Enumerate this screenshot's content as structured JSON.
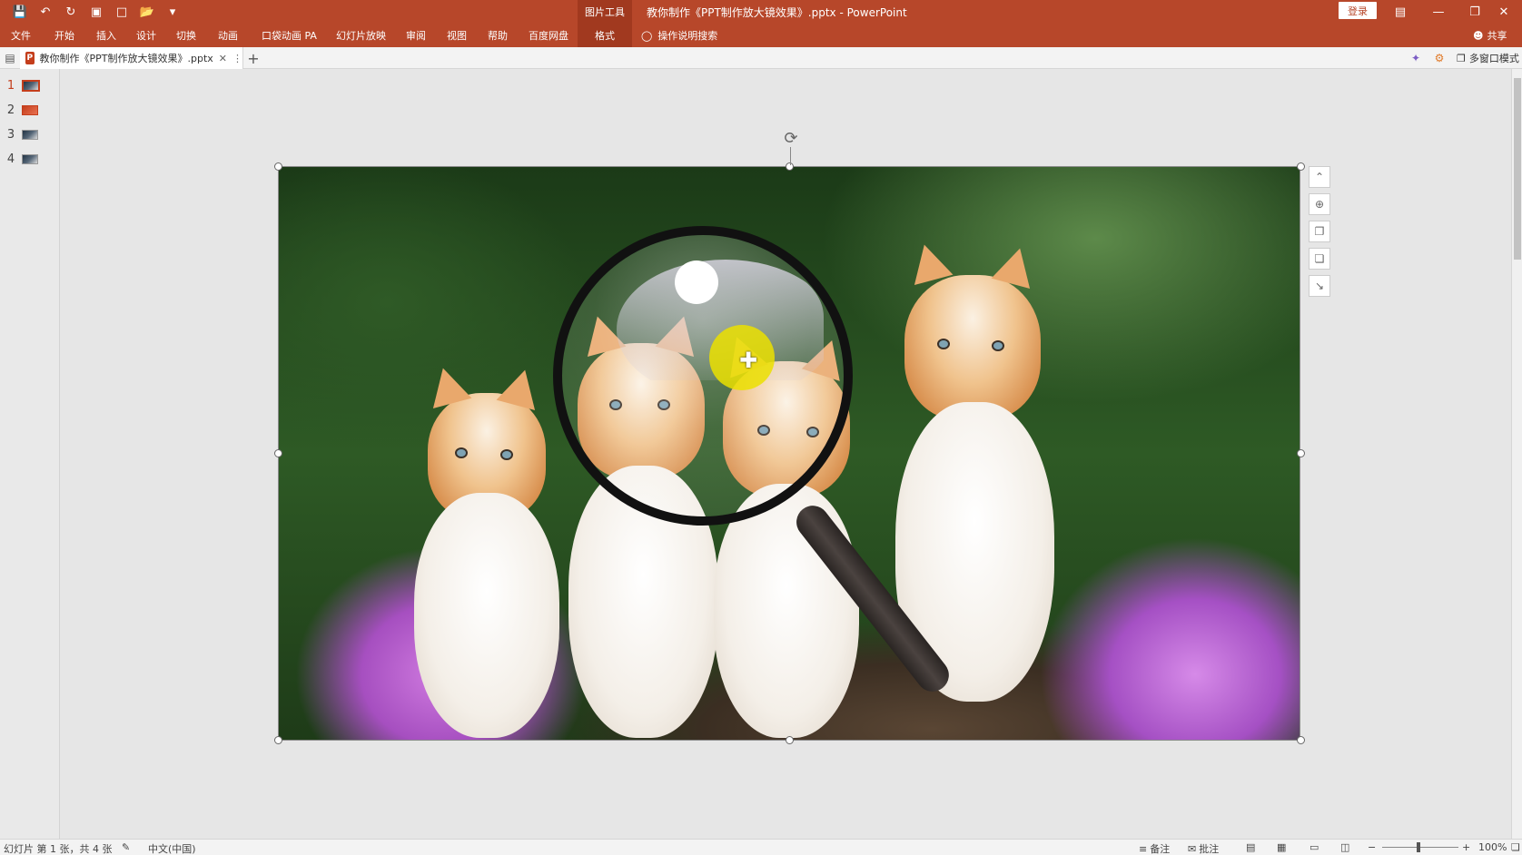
{
  "titlebar": {
    "context_tab_group": "图片工具",
    "document_title": "教你制作《PPT制作放大镜效果》.pptx  -  PowerPoint",
    "login_label": "登录",
    "qat_icons": [
      "save-icon",
      "undo-icon",
      "redo-icon",
      "presenter-icon",
      "new-file-icon",
      "open-folder-icon",
      "customize-qat-icon"
    ]
  },
  "ribbon": {
    "tabs": [
      {
        "label": "文件"
      },
      {
        "label": "开始"
      },
      {
        "label": "插入"
      },
      {
        "label": "设计"
      },
      {
        "label": "切换"
      },
      {
        "label": "动画"
      },
      {
        "label": "口袋动画 PA"
      },
      {
        "label": "幻灯片放映"
      },
      {
        "label": "审阅"
      },
      {
        "label": "视图"
      },
      {
        "label": "帮助"
      },
      {
        "label": "百度网盘"
      },
      {
        "label": "格式"
      }
    ],
    "active_tab": "格式",
    "tell_me": "操作说明搜索",
    "share": "共享"
  },
  "docstrip": {
    "tab_label": "教你制作《PPT制作放大镜效果》.pptx",
    "badge": "P",
    "multi_window": "多窗口模式"
  },
  "thumbnails": [
    {
      "num": "1",
      "selected": true
    },
    {
      "num": "2",
      "selected": false
    },
    {
      "num": "3",
      "selected": false
    },
    {
      "num": "4",
      "selected": false
    }
  ],
  "status": {
    "slide_info": "幻灯片 第 1 张，共 4 张",
    "language": "中文(中国)",
    "notes": "备注",
    "comments": "批注",
    "zoom": "100%"
  },
  "colors": {
    "accent": "#b7472a",
    "accent_dark": "#a1391f",
    "highlight": "#ebe100"
  }
}
